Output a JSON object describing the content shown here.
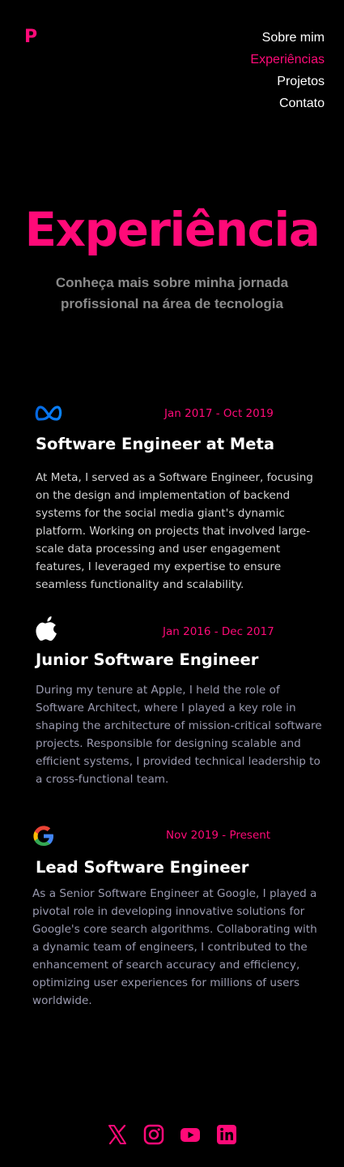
{
  "logo": {
    "text": "P"
  },
  "nav": {
    "items": [
      {
        "label": "Sobre mim",
        "active": false
      },
      {
        "label": "Experiências",
        "active": true
      },
      {
        "label": "Projetos",
        "active": false
      },
      {
        "label": "Contato",
        "active": false
      }
    ]
  },
  "hero": {
    "title": "Experiência",
    "subtitle": "Conheça mais sobre minha jornada profissional na área de tecnologia"
  },
  "experiences": [
    {
      "icon": "meta-logo-icon",
      "date": "Jan 2017 - Oct 2019",
      "title": "Software Engineer at Meta",
      "description": "At Meta, I served as a  Software Engineer, focusing on the design and implementation of backend systems for the social media giant's dynamic platform. Working on projects that involved large-scale data processing and user engagement features, I leveraged my expertise to ensure seamless functionality and scalability."
    },
    {
      "icon": "apple-logo-icon",
      "date": "Jan 2016 - Dec 2017",
      "title": "Junior Software Engineer",
      "description": "During my tenure at Apple, I held the role of Software Architect, where I played a key role in shaping the architecture of mission-critical software projects. Responsible for designing scalable and efficient systems, I provided technical leadership to a cross-functional team."
    },
    {
      "icon": "google-logo-icon",
      "date": "Nov 2019 - Present",
      "title": "Lead Software Engineer",
      "description": "As a Senior Software Engineer at Google, I played a pivotal role in developing innovative solutions for Google's core search algorithms. Collaborating with a dynamic team of engineers, I contributed to the enhancement of search accuracy and efficiency, optimizing user experiences for millions of users worldwide."
    }
  ],
  "footer": {
    "social": [
      "x-icon",
      "instagram-icon",
      "youtube-icon",
      "linkedin-icon"
    ]
  },
  "colors": {
    "accent": "#ff0a78",
    "background": "#000000",
    "text": "#ffffff",
    "muted": "#8a8a8a",
    "desc_light": "#d4d4d4",
    "desc_dim": "#9a9ab0"
  }
}
